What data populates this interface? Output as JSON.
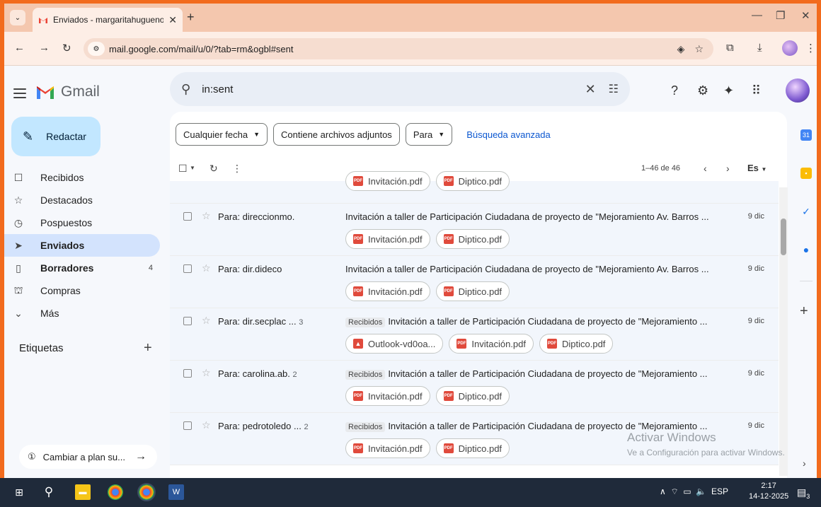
{
  "browser": {
    "tab_title": "Enviados - margaritahugueno@",
    "url": "mail.google.com/mail/u/0/?tab=rm&ogbl#sent"
  },
  "gmail": {
    "app_name": "Gmail",
    "search_value": "in:sent",
    "compose_label": "Redactar",
    "nav": [
      {
        "label": "Recibidos",
        "icon": "inbox-icon",
        "glyph": "☐",
        "count": ""
      },
      {
        "label": "Destacados",
        "icon": "star-icon",
        "glyph": "☆",
        "count": ""
      },
      {
        "label": "Pospuestos",
        "icon": "clock-icon",
        "glyph": "◷",
        "count": ""
      },
      {
        "label": "Enviados",
        "icon": "send-icon",
        "glyph": "➤",
        "count": ""
      },
      {
        "label": "Borradores",
        "icon": "draft-icon",
        "glyph": "▯",
        "count": "4"
      },
      {
        "label": "Compras",
        "icon": "shopping-icon",
        "glyph": "⛫",
        "count": ""
      },
      {
        "label": "Más",
        "icon": "chevron-down-icon",
        "glyph": "⌄",
        "count": ""
      }
    ],
    "labels_heading": "Etiquetas",
    "upgrade_label": "Cambiar a plan su...",
    "filters": {
      "date": "Cualquier fecha",
      "attachments": "Contiene archivos adjuntos",
      "to": "Para",
      "advanced": "Búsqueda avanzada"
    },
    "pagination": "1–46 de 46",
    "lang": "Es",
    "partial_attachments": [
      "Invitación.pdf",
      "Diptico.pdf"
    ],
    "emails": [
      {
        "to": "Para: direccionmo.",
        "count": "",
        "tag": "",
        "subject": "Invitación a taller de Participación Ciudadana de proyecto de \"Mejoramiento Av. Barros ...",
        "date": "9 dic",
        "attachments": [
          {
            "name": "Invitación.pdf",
            "type": "pdf"
          },
          {
            "name": "Diptico.pdf",
            "type": "pdf"
          }
        ]
      },
      {
        "to": "Para: dir.dideco",
        "count": "",
        "tag": "",
        "subject": "Invitación a taller de Participación Ciudadana de proyecto de \"Mejoramiento Av. Barros ...",
        "date": "9 dic",
        "attachments": [
          {
            "name": "Invitación.pdf",
            "type": "pdf"
          },
          {
            "name": "Diptico.pdf",
            "type": "pdf"
          }
        ]
      },
      {
        "to": "Para: dir.secplac ...",
        "count": "3",
        "tag": "Recibidos",
        "subject": "Invitación a taller de Participación Ciudadana de proyecto de \"Mejoramiento ...",
        "date": "9 dic",
        "attachments": [
          {
            "name": "Outlook-vd0oa...",
            "type": "image"
          },
          {
            "name": "Invitación.pdf",
            "type": "pdf"
          },
          {
            "name": "Diptico.pdf",
            "type": "pdf"
          }
        ]
      },
      {
        "to": "Para: carolina.ab.",
        "count": "2",
        "tag": "Recibidos",
        "subject": "Invitación a taller de Participación Ciudadana de proyecto de \"Mejoramiento ...",
        "date": "9 dic",
        "attachments": [
          {
            "name": "Invitación.pdf",
            "type": "pdf"
          },
          {
            "name": "Diptico.pdf",
            "type": "pdf"
          }
        ]
      },
      {
        "to": "Para: pedrotoledo ...",
        "count": "2",
        "tag": "Recibidos",
        "subject": "Invitación a taller de Participación Ciudadana de proyecto de \"Mejoramiento ...",
        "date": "9 dic",
        "attachments": [
          {
            "name": "Invitación.pdf",
            "type": "pdf"
          },
          {
            "name": "Diptico.pdf",
            "type": "pdf"
          }
        ]
      }
    ]
  },
  "watermark": {
    "title": "Activar Windows",
    "subtitle": "Ve a Configuración para activar Windows."
  },
  "taskbar": {
    "lang": "ESP",
    "time": "2:17",
    "date": "14-12-2025",
    "notifications": "3"
  },
  "colors": {
    "accent": "#0b57d0",
    "compose": "#c2e7ff",
    "active_nav": "#d3e3fd",
    "frame": "#f26b1d"
  }
}
